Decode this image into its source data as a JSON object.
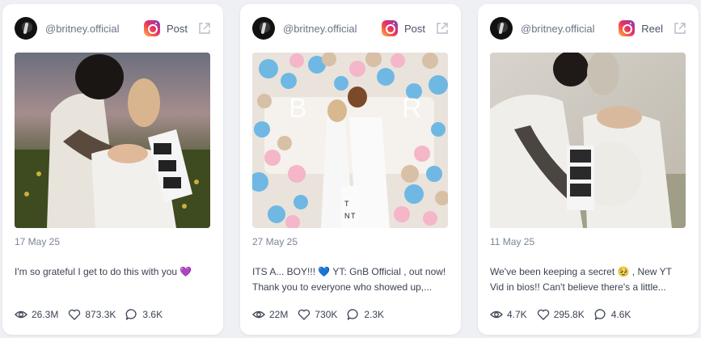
{
  "cards": [
    {
      "handle": "@britney.official",
      "platform_icon": "instagram-icon",
      "post_type": "Post",
      "date": "17 May 25",
      "caption_lines": [
        "I'm so grateful I get to do this with you 💜"
      ],
      "stats": {
        "views": "26.3M",
        "likes": "873.3K",
        "comments": "3.6K"
      }
    },
    {
      "handle": "@britney.official",
      "platform_icon": "instagram-icon",
      "post_type": "Post",
      "date": "27 May 25",
      "caption_lines": [
        "ITS A... BOY!!! 💙 YT: GnB Official , out now!",
        "Thank you to everyone who showed up,..."
      ],
      "stats": {
        "views": "22M",
        "likes": "730K",
        "comments": "2.3K"
      }
    },
    {
      "handle": "@britney.official",
      "platform_icon": "instagram-icon",
      "post_type": "Reel",
      "date": "11 May 25",
      "caption_lines": [
        "We've been keeping a secret 🥹 , New YT",
        "Vid in bios!! Can't believe there's a little..."
      ],
      "stats": {
        "views": "4.7K",
        "likes": "295.8K",
        "comments": "4.6K"
      }
    }
  ],
  "colors": {
    "card_bg": "#ffffff",
    "page_bg": "#eef0f4",
    "text": "#3b4252",
    "muted": "#7b8496"
  }
}
